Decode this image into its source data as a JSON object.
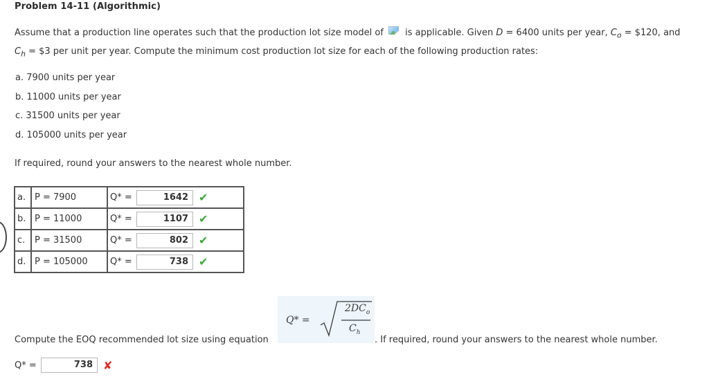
{
  "problem": {
    "title": "Problem 14-11 (Algorithmic)",
    "intro": {
      "part1": "Assume that a production line operates such that the production lot size model of ",
      "part2": " is applicable. Given ",
      "d_symbol": "D",
      "d_value": " = 6400 units per year, ",
      "co_symbol": "C",
      "co_sub": "o",
      "co_value": " = $120, and",
      "ch_symbol": "C",
      "ch_sub": "h",
      "ch_value": " = $3 per unit per year. Compute the minimum cost production lot size for each of the following production rates:"
    },
    "options": [
      "a. 7900 units per year",
      "b. 11000 units per year",
      "c. 31500 units per year",
      "d. 105000 units per year"
    ],
    "round_note": "If required, round your answers to the nearest whole number."
  },
  "answers_table": {
    "rows": [
      {
        "letter": "a.",
        "p_label": "P = 7900",
        "q_label": "Q* =",
        "value": "1642",
        "status": "correct"
      },
      {
        "letter": "b.",
        "p_label": "P = 11000",
        "q_label": "Q* =",
        "value": "1107",
        "status": "correct"
      },
      {
        "letter": "c.",
        "p_label": "P = 31500",
        "q_label": "Q* =",
        "value": "802",
        "status": "correct"
      },
      {
        "letter": "d.",
        "p_label": "P = 105000",
        "q_label": "Q* =",
        "value": "738",
        "status": "correct"
      }
    ],
    "check_glyph": "✔",
    "check_color": "#3aa83a"
  },
  "eoq": {
    "prompt": "Compute the EOQ recommended lot size using equation",
    "tail": ". If required, round your answers to the nearest whole number.",
    "formula": {
      "lhs": "Q* =",
      "numerator": "2DC",
      "numerator_sub": "o",
      "denominator": "C",
      "denominator_sub": "h"
    },
    "q_label": "Q* =",
    "value": "738",
    "cross_glyph": "✘",
    "cross_color": "#d93025"
  }
}
